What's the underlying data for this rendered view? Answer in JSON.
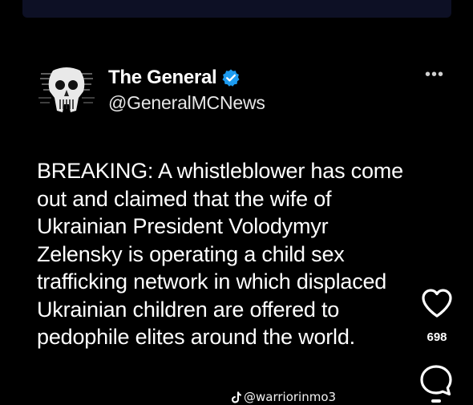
{
  "post": {
    "author": {
      "display_name": "The General",
      "handle": "@GeneralMCNews",
      "verified": true,
      "avatar_icon": "punisher-skull-avatar"
    },
    "more_icon": "more-dots-icon",
    "text_lines": [
      "BREAKING: A whistleblower has come",
      "out and claimed that the wife of",
      "Ukrainian President Volodymyr",
      "Zelensky is operating a child sex",
      "trafficking network in which displaced",
      "Ukrainian children are offered to",
      "pedophile elites around the world."
    ]
  },
  "side_actions": {
    "like_icon": "heart-icon",
    "like_count": "698",
    "comment_icon": "comment-bubble-icon"
  },
  "watermark": {
    "icon": "tiktok-icon",
    "text": "@warriorinmo3"
  },
  "colors": {
    "background": "#000000",
    "top_band": "#0d1025",
    "verified_badge": "#1d9bf0",
    "text": "#ffffff"
  }
}
